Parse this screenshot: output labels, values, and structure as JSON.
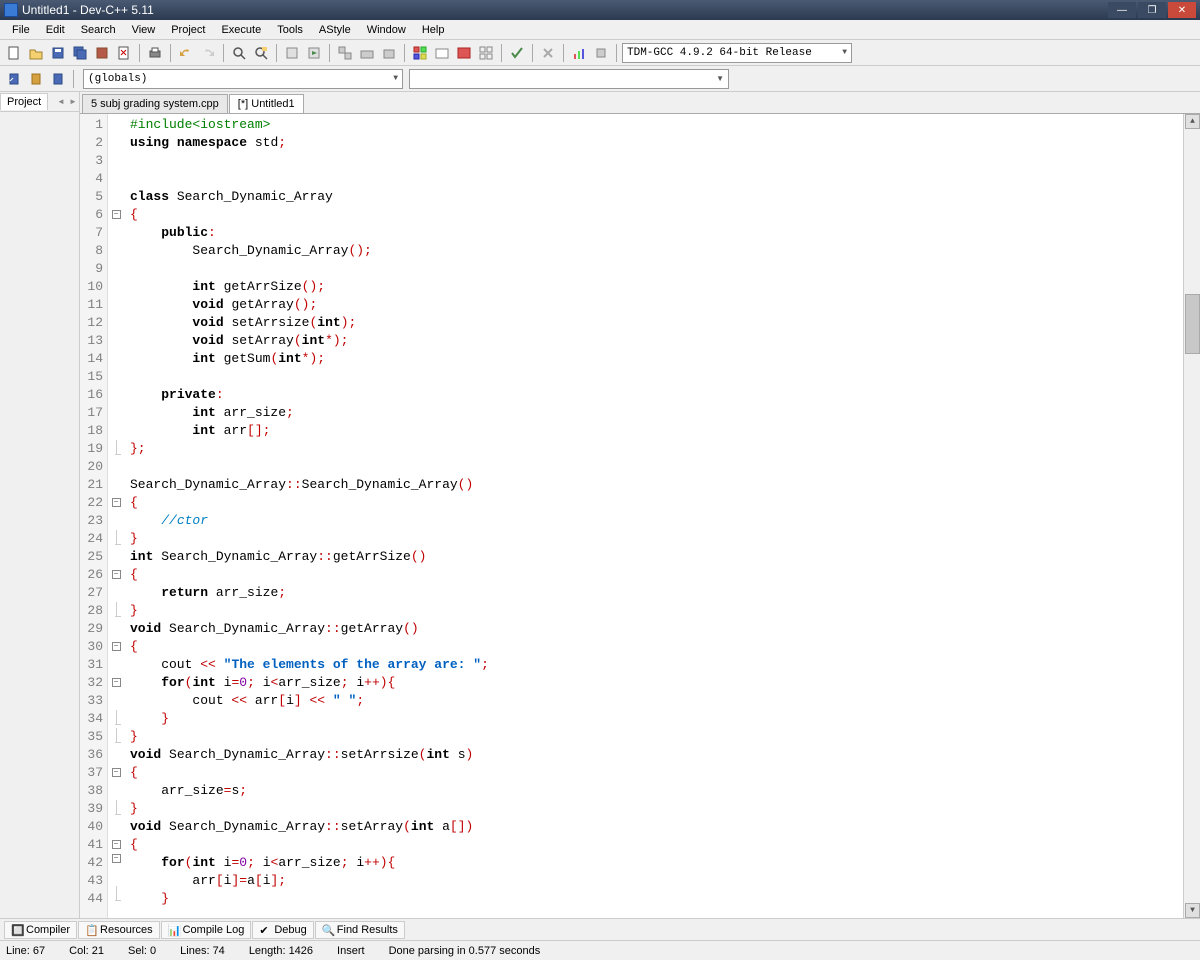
{
  "title": "Untitled1 - Dev-C++ 5.11",
  "menu": [
    "File",
    "Edit",
    "Search",
    "View",
    "Project",
    "Execute",
    "Tools",
    "AStyle",
    "Window",
    "Help"
  ],
  "compiler": "TDM-GCC 4.9.2 64-bit Release",
  "globals": "(globals)",
  "leftTab": "Project",
  "fileTabs": [
    {
      "label": "5 subj grading system.cpp",
      "active": false
    },
    {
      "label": "[*] Untitled1",
      "active": true
    }
  ],
  "bottomTabs": [
    "Compiler",
    "Resources",
    "Compile Log",
    "Debug",
    "Find Results"
  ],
  "status": {
    "line": "Line:   67",
    "col": "Col:   21",
    "sel": "Sel:   0",
    "lines": "Lines:   74",
    "length": "Length:   1426",
    "mode": "Insert",
    "msg": "Done parsing in 0.577 seconds"
  },
  "code": [
    {
      "n": 1,
      "t": [
        {
          "c": "pp",
          "s": "#include<iostream>"
        }
      ]
    },
    {
      "n": 2,
      "t": [
        {
          "c": "kw",
          "s": "using"
        },
        {
          "s": " "
        },
        {
          "c": "kw",
          "s": "namespace"
        },
        {
          "s": " std"
        },
        {
          "c": "op",
          "s": ";"
        }
      ]
    },
    {
      "n": 3,
      "t": []
    },
    {
      "n": 4,
      "t": []
    },
    {
      "n": 5,
      "t": [
        {
          "c": "kw",
          "s": "class"
        },
        {
          "s": " Search_Dynamic_Array"
        }
      ]
    },
    {
      "n": 6,
      "f": "open",
      "t": [
        {
          "c": "op",
          "s": "{"
        }
      ]
    },
    {
      "n": 7,
      "t": [
        {
          "s": "    "
        },
        {
          "c": "kw",
          "s": "public"
        },
        {
          "c": "op",
          "s": ":"
        }
      ]
    },
    {
      "n": 8,
      "t": [
        {
          "s": "        Search_Dynamic_Array"
        },
        {
          "c": "op",
          "s": "();"
        }
      ]
    },
    {
      "n": 9,
      "t": []
    },
    {
      "n": 10,
      "t": [
        {
          "s": "        "
        },
        {
          "c": "kw",
          "s": "int"
        },
        {
          "s": " getArrSize"
        },
        {
          "c": "op",
          "s": "();"
        }
      ]
    },
    {
      "n": 11,
      "t": [
        {
          "s": "        "
        },
        {
          "c": "kw",
          "s": "void"
        },
        {
          "s": " getArray"
        },
        {
          "c": "op",
          "s": "();"
        }
      ]
    },
    {
      "n": 12,
      "t": [
        {
          "s": "        "
        },
        {
          "c": "kw",
          "s": "void"
        },
        {
          "s": " setArrsize"
        },
        {
          "c": "op",
          "s": "("
        },
        {
          "c": "kw",
          "s": "int"
        },
        {
          "c": "op",
          "s": ");"
        }
      ]
    },
    {
      "n": 13,
      "t": [
        {
          "s": "        "
        },
        {
          "c": "kw",
          "s": "void"
        },
        {
          "s": " setArray"
        },
        {
          "c": "op",
          "s": "("
        },
        {
          "c": "kw",
          "s": "int"
        },
        {
          "c": "op",
          "s": "*);"
        }
      ]
    },
    {
      "n": 14,
      "t": [
        {
          "s": "        "
        },
        {
          "c": "kw",
          "s": "int"
        },
        {
          "s": " getSum"
        },
        {
          "c": "op",
          "s": "("
        },
        {
          "c": "kw",
          "s": "int"
        },
        {
          "c": "op",
          "s": "*);"
        }
      ]
    },
    {
      "n": 15,
      "t": []
    },
    {
      "n": 16,
      "t": [
        {
          "s": "    "
        },
        {
          "c": "kw",
          "s": "private"
        },
        {
          "c": "op",
          "s": ":"
        }
      ]
    },
    {
      "n": 17,
      "t": [
        {
          "s": "        "
        },
        {
          "c": "kw",
          "s": "int"
        },
        {
          "s": " arr_size"
        },
        {
          "c": "op",
          "s": ";"
        }
      ]
    },
    {
      "n": 18,
      "t": [
        {
          "s": "        "
        },
        {
          "c": "kw",
          "s": "int"
        },
        {
          "s": " arr"
        },
        {
          "c": "op",
          "s": "[];"
        }
      ]
    },
    {
      "n": 19,
      "f": "end",
      "t": [
        {
          "c": "op",
          "s": "};"
        }
      ]
    },
    {
      "n": 20,
      "t": []
    },
    {
      "n": 21,
      "t": [
        {
          "s": "Search_Dynamic_Array"
        },
        {
          "c": "op",
          "s": "::"
        },
        {
          "s": "Search_Dynamic_Array"
        },
        {
          "c": "op",
          "s": "()"
        }
      ]
    },
    {
      "n": 22,
      "f": "open",
      "t": [
        {
          "c": "op",
          "s": "{"
        }
      ]
    },
    {
      "n": 23,
      "t": [
        {
          "s": "    "
        },
        {
          "c": "cmt",
          "s": "//ctor"
        }
      ]
    },
    {
      "n": 24,
      "f": "end",
      "t": [
        {
          "c": "op",
          "s": "}"
        }
      ]
    },
    {
      "n": 25,
      "t": [
        {
          "c": "kw",
          "s": "int"
        },
        {
          "s": " Search_Dynamic_Array"
        },
        {
          "c": "op",
          "s": "::"
        },
        {
          "s": "getArrSize"
        },
        {
          "c": "op",
          "s": "()"
        }
      ]
    },
    {
      "n": 26,
      "f": "open",
      "t": [
        {
          "c": "op",
          "s": "{"
        }
      ]
    },
    {
      "n": 27,
      "t": [
        {
          "s": "    "
        },
        {
          "c": "kw",
          "s": "return"
        },
        {
          "s": " arr_size"
        },
        {
          "c": "op",
          "s": ";"
        }
      ]
    },
    {
      "n": 28,
      "f": "end",
      "t": [
        {
          "c": "op",
          "s": "}"
        }
      ]
    },
    {
      "n": 29,
      "t": [
        {
          "c": "kw",
          "s": "void"
        },
        {
          "s": " Search_Dynamic_Array"
        },
        {
          "c": "op",
          "s": "::"
        },
        {
          "s": "getArray"
        },
        {
          "c": "op",
          "s": "()"
        }
      ]
    },
    {
      "n": 30,
      "f": "open",
      "t": [
        {
          "c": "op",
          "s": "{"
        }
      ]
    },
    {
      "n": 31,
      "t": [
        {
          "s": "    cout "
        },
        {
          "c": "op",
          "s": "<<"
        },
        {
          "s": " "
        },
        {
          "c": "str",
          "s": "\"The elements of the array are: \""
        },
        {
          "c": "op",
          "s": ";"
        }
      ]
    },
    {
      "n": 32,
      "f": "open",
      "t": [
        {
          "s": "    "
        },
        {
          "c": "kw",
          "s": "for"
        },
        {
          "c": "op",
          "s": "("
        },
        {
          "c": "kw",
          "s": "int"
        },
        {
          "s": " i"
        },
        {
          "c": "op",
          "s": "="
        },
        {
          "c": "num",
          "s": "0"
        },
        {
          "c": "op",
          "s": ";"
        },
        {
          "s": " i"
        },
        {
          "c": "op",
          "s": "<"
        },
        {
          "s": "arr_size"
        },
        {
          "c": "op",
          "s": ";"
        },
        {
          "s": " i"
        },
        {
          "c": "op",
          "s": "++){"
        }
      ]
    },
    {
      "n": 33,
      "t": [
        {
          "s": "        cout "
        },
        {
          "c": "op",
          "s": "<<"
        },
        {
          "s": " arr"
        },
        {
          "c": "op",
          "s": "["
        },
        {
          "s": "i"
        },
        {
          "c": "op",
          "s": "]"
        },
        {
          "s": " "
        },
        {
          "c": "op",
          "s": "<<"
        },
        {
          "s": " "
        },
        {
          "c": "str",
          "s": "\" \""
        },
        {
          "c": "op",
          "s": ";"
        }
      ]
    },
    {
      "n": 34,
      "f": "mid",
      "t": [
        {
          "s": "    "
        },
        {
          "c": "op",
          "s": "}"
        }
      ]
    },
    {
      "n": 35,
      "f": "end",
      "t": [
        {
          "c": "op",
          "s": "}"
        }
      ]
    },
    {
      "n": 36,
      "t": [
        {
          "c": "kw",
          "s": "void"
        },
        {
          "s": " Search_Dynamic_Array"
        },
        {
          "c": "op",
          "s": "::"
        },
        {
          "s": "setArrsize"
        },
        {
          "c": "op",
          "s": "("
        },
        {
          "c": "kw",
          "s": "int"
        },
        {
          "s": " s"
        },
        {
          "c": "op",
          "s": ")"
        }
      ]
    },
    {
      "n": 37,
      "f": "open",
      "t": [
        {
          "c": "op",
          "s": "{"
        }
      ]
    },
    {
      "n": 38,
      "t": [
        {
          "s": "    arr_size"
        },
        {
          "c": "op",
          "s": "="
        },
        {
          "s": "s"
        },
        {
          "c": "op",
          "s": ";"
        }
      ]
    },
    {
      "n": 39,
      "f": "end",
      "t": [
        {
          "c": "op",
          "s": "}"
        }
      ]
    },
    {
      "n": 40,
      "t": [
        {
          "c": "kw",
          "s": "void"
        },
        {
          "s": " Search_Dynamic_Array"
        },
        {
          "c": "op",
          "s": "::"
        },
        {
          "s": "setArray"
        },
        {
          "c": "op",
          "s": "("
        },
        {
          "c": "kw",
          "s": "int"
        },
        {
          "s": " a"
        },
        {
          "c": "op",
          "s": "[])"
        }
      ]
    },
    {
      "n": 41,
      "f": "open",
      "t": [
        {
          "c": "op",
          "s": "{"
        }
      ]
    },
    {
      "n": 42,
      "f": "open",
      "t": [
        {
          "s": "    "
        },
        {
          "c": "kw",
          "s": "for"
        },
        {
          "c": "op",
          "s": "("
        },
        {
          "c": "kw",
          "s": "int"
        },
        {
          "s": " i"
        },
        {
          "c": "op",
          "s": "="
        },
        {
          "c": "num",
          "s": "0"
        },
        {
          "c": "op",
          "s": ";"
        },
        {
          "s": " i"
        },
        {
          "c": "op",
          "s": "<"
        },
        {
          "s": "arr_size"
        },
        {
          "c": "op",
          "s": ";"
        },
        {
          "s": " i"
        },
        {
          "c": "op",
          "s": "++){"
        }
      ]
    },
    {
      "n": 43,
      "t": [
        {
          "s": "        arr"
        },
        {
          "c": "op",
          "s": "["
        },
        {
          "s": "i"
        },
        {
          "c": "op",
          "s": "]="
        },
        {
          "s": "a"
        },
        {
          "c": "op",
          "s": "["
        },
        {
          "s": "i"
        },
        {
          "c": "op",
          "s": "];"
        }
      ]
    },
    {
      "n": 44,
      "f": "mid",
      "t": [
        {
          "s": "    "
        },
        {
          "c": "op",
          "s": "}"
        }
      ]
    }
  ]
}
